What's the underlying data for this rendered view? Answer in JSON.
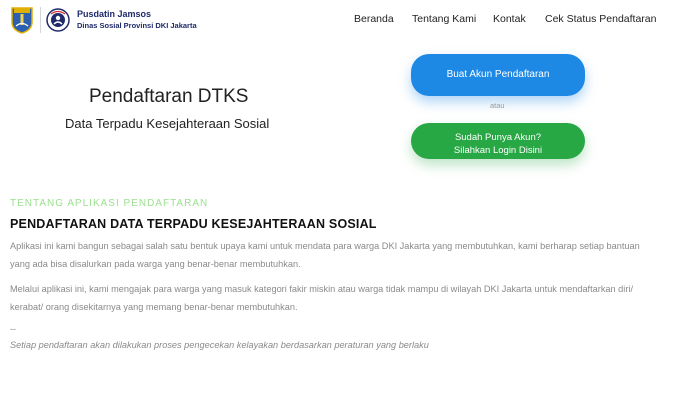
{
  "header": {
    "brand_title": "Pusdatin Jamsos",
    "brand_subtitle": "Dinas Sosial Provinsi DKI Jakarta",
    "nav": [
      "Beranda",
      "Tentang Kami",
      "Kontak",
      "Cek Status Pendaftaran"
    ]
  },
  "hero": {
    "title": "Pendaftaran DTKS",
    "subtitle": "Data Terpadu Kesejahteraan Sosial",
    "create_account_label": "Buat Akun Pendaftaran",
    "or_label": "atau",
    "login_line1": "Sudah Punya Akun?",
    "login_line2": "Silahkan Login Disini"
  },
  "about": {
    "tag": "TENTANG APLIKASI PENDAFTARAN",
    "heading": "PENDAFTARAN DATA TERPADU KESEJAHTERAAN SOSIAL",
    "paragraph1_line1": "Aplikasi ini kami bangun sebagai salah satu bentuk upaya kami untuk mendata para warga DKI Jakarta yang membutuhkan, kami berharap setiap bantuan",
    "paragraph1_line2": "yang ada bisa disalurkan pada warga yang benar-benar membutuhkan.",
    "paragraph2_line1": "Melalui aplikasi ini, kami mengajak para warga yang masuk kategori fakir miskin atau warga tidak mampu di wilayah DKI Jakarta untuk mendaftarkan diri/",
    "paragraph2_line2": "kerabat/ orang disekitarnya yang memang benar-benar membutuhkan.",
    "separator": "--",
    "note": "Setiap pendaftaran akan dilakukan proses pengecekan kelayakan berdasarkan peraturan yang berlaku"
  },
  "colors": {
    "primary_button": "#1e88e5",
    "secondary_button": "#28a745",
    "section_tag": "#9be08f",
    "brand": "#1f2a6b"
  }
}
